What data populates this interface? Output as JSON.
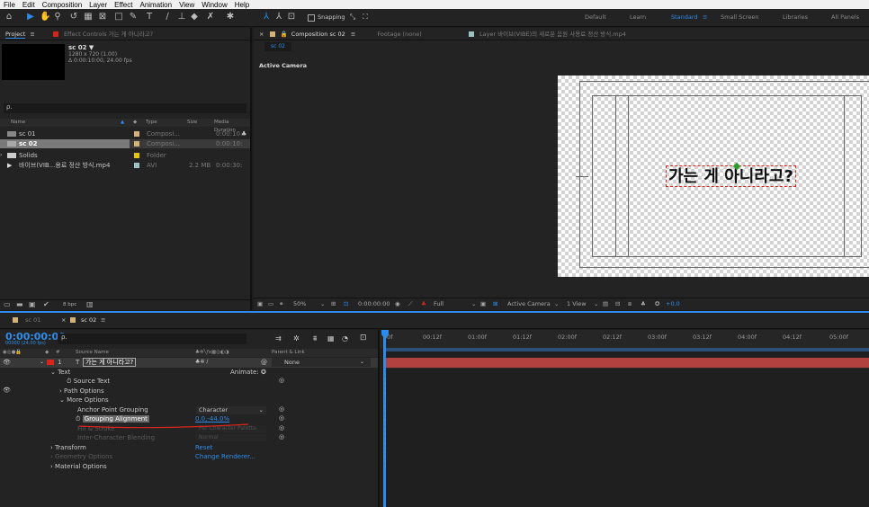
{
  "menu": [
    "File",
    "Edit",
    "Composition",
    "Layer",
    "Effect",
    "Animation",
    "View",
    "Window",
    "Help"
  ],
  "toolbar": {
    "snapping_label": "Snapping",
    "workspaces": [
      "Default",
      "Learn",
      "Standard",
      "Small Screen",
      "Libraries",
      "All Panels"
    ],
    "active_workspace": "Standard"
  },
  "project": {
    "tab_label": "Project",
    "effect_controls_label": "Effect Controls 가는 게 아니라고?",
    "selected_name": "sc 02 ▼",
    "selected_info1": "1280 x 720 (1.00)",
    "selected_info2": "Δ 0:00:10:00, 24.00 fps",
    "search_placeholder": "ρ.",
    "columns": [
      "Name",
      "Type",
      "Size",
      "Media Duration"
    ],
    "items": [
      {
        "name": "sc 01",
        "type": "Composi...",
        "size": "",
        "duration": "0:00:10:"
      },
      {
        "name": "sc 02",
        "type": "Composi...",
        "size": "",
        "duration": "0:00:10:"
      },
      {
        "name": "Solids",
        "type": "Folder",
        "size": "",
        "duration": ""
      },
      {
        "name": "바이브(VIB...용료 정산 방식.mp4",
        "type": "AVI",
        "size": "2.2 MB",
        "duration": "0:00:30:"
      }
    ],
    "bpc_label": "8 bpc"
  },
  "composition": {
    "tab_label": "Composition sc 02",
    "footage_label": "Footage (none)",
    "layer_label": "Layer 바이브(VIBE)의 새로운 음원 사용료 정산 방식.mp4",
    "crumb": "sc 02",
    "active_camera": "Active Camera",
    "canvas_text": "가는 게 아니라고?",
    "footer": {
      "zoom": "50%",
      "timecode": "0:00:00:00",
      "resolution": "Full",
      "camera": "Active Camera",
      "views": "1 View",
      "exposure": "+0.0"
    }
  },
  "timeline": {
    "tabs": [
      "sc 01",
      "sc 02"
    ],
    "timecode": "0:00:00:00",
    "fps": "00000 (24.00 fps)",
    "search_placeholder": "ρ.",
    "ruler": [
      "00f",
      "00:12f",
      "01:00f",
      "01:12f",
      "02:00f",
      "02:12f",
      "03:00f",
      "03:12f",
      "04:00f",
      "04:12f",
      "05:00f"
    ],
    "col_source": "Source Name",
    "col_parent": "Parent & Link",
    "layer": {
      "num": "1",
      "name": "가는 게 아니라고?",
      "parent": "None"
    },
    "props": [
      {
        "indent": 0,
        "label": "Text",
        "value": "Animate:"
      },
      {
        "indent": 1,
        "label": "Source Text",
        "value": ""
      },
      {
        "indent": 1,
        "label": "Path Options",
        "value": ""
      },
      {
        "indent": 1,
        "label": "More Options",
        "value": ""
      },
      {
        "indent": 2,
        "label": "Anchor Point Grouping",
        "value": "Character"
      },
      {
        "indent": 2,
        "label": "Grouping Alignment",
        "value": "0.0,-44.0%"
      },
      {
        "indent": 2,
        "label": "Fill & Stroke",
        "value": "Per Character Palette"
      },
      {
        "indent": 2,
        "label": "Inter-Character Blending",
        "value": "Normal"
      },
      {
        "indent": 0,
        "label": "Transform",
        "value": "Reset"
      },
      {
        "indent": 0,
        "label": "Geometry Options",
        "value": "Change Renderer..."
      },
      {
        "indent": 0,
        "label": "Material Options",
        "value": ""
      }
    ]
  },
  "colors": {
    "accent": "#2d8ceb",
    "layer_bar": "#b0413e",
    "label_tan": "#d4b37a",
    "annotation": "#d9241b"
  }
}
